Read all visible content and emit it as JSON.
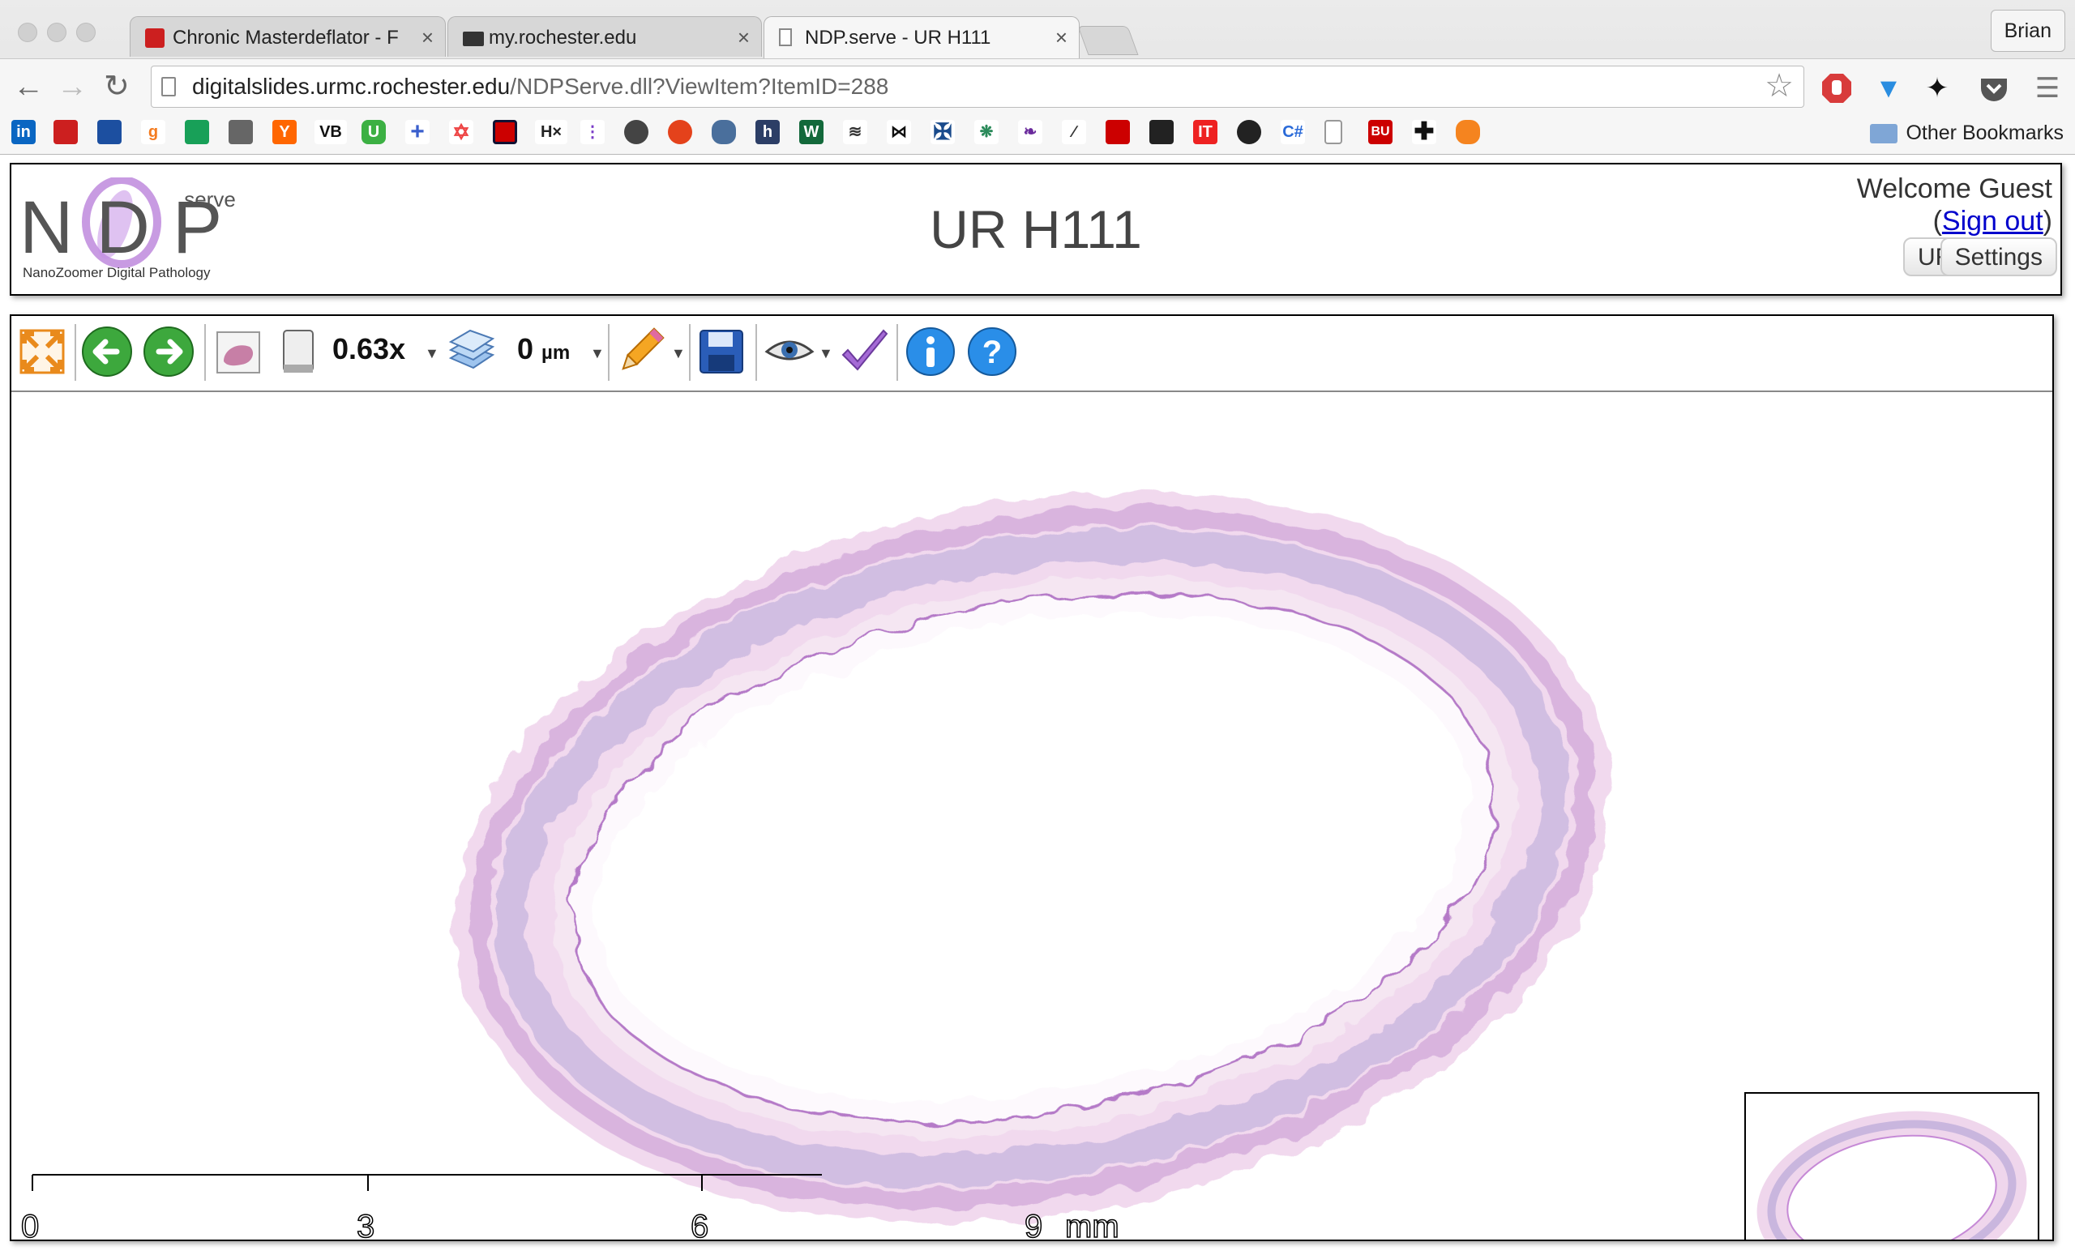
{
  "browser": {
    "tabs": [
      {
        "title": "Chronic Masterdeflator - Fr"
      },
      {
        "title": "my.rochester.edu"
      },
      {
        "title": "NDP.serve - UR H111"
      }
    ],
    "user_label": "Brian",
    "url_host": "digitalslides.urmc.rochester.edu",
    "url_path": "/NDPServe.dll?ViewItem?ItemID=288",
    "other_bookmarks": "Other Bookmarks",
    "bookmark_labels": [
      "in",
      "H×",
      "C#",
      "BU",
      "VB",
      "U",
      "Y",
      "g"
    ]
  },
  "header": {
    "logo_text": "NanoZoomer Digital Pathology",
    "logo_serve": ".serve",
    "logo_letters": "NDP",
    "title": "UR H111",
    "welcome": "Welcome Guest",
    "signout_open": "(",
    "signout_label": "Sign out",
    "signout_close": ")",
    "url_button": "URL",
    "settings_button": "Settings"
  },
  "toolbar": {
    "zoom": "0.63x",
    "focus_value": "0",
    "focus_unit": "µm"
  },
  "scalebar": {
    "ticks": [
      "0",
      "3",
      "6",
      "9"
    ],
    "unit": "mm"
  }
}
